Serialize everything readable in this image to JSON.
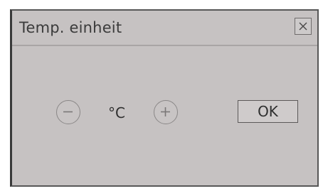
{
  "dialog": {
    "title": "Temp. einheit",
    "close_icon": "close-icon",
    "unit_value": "°C",
    "decrement_icon": "minus-icon",
    "increment_icon": "plus-icon",
    "ok_label": "OK"
  },
  "colors": {
    "background": "#c6c2c2",
    "border": "#575757",
    "text": "#3b3b3b"
  }
}
